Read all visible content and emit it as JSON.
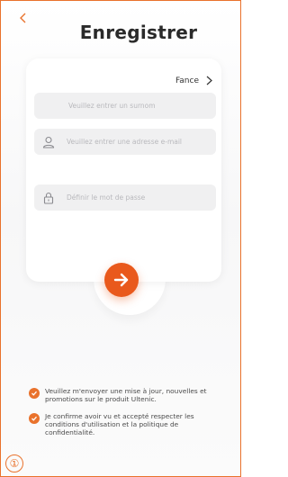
{
  "header": {
    "title": "Enregistrer",
    "back_icon": "chevron-left-icon"
  },
  "form": {
    "country": "Fance",
    "nickname_placeholder": "Veuillez entrer un surnom",
    "email_placeholder": "Veuillez entrer une adresse e-mail",
    "password_placeholder": "Définir le mot de passe"
  },
  "submit": {
    "icon": "arrow-right-icon"
  },
  "consents": [
    {
      "text": "Veuillez m'envoyer une mise à jour, nouvelles et promotions sur le produit Ultenic.",
      "checked": true
    },
    {
      "text": "Je confirme avoir vu et accepté respecter les conditions d'utilisation et la politique de confidentialité.",
      "checked": true
    }
  ],
  "marker": "①",
  "colors": {
    "accent": "#e9722c",
    "button": "#e9591c",
    "field": "#f0f0f1"
  }
}
